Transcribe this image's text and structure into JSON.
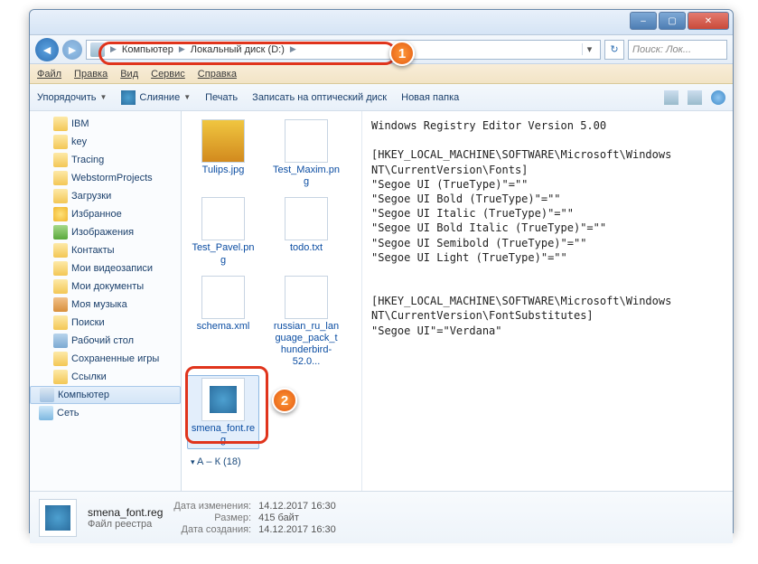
{
  "titlebar": {
    "min": "–",
    "max": "▢",
    "close": "✕"
  },
  "nav": {
    "back": "◄",
    "fwd": "►",
    "refresh": "↻",
    "dropdown": "▾",
    "crumbs": [
      "Компьютер",
      "Локальный диск (D:)"
    ],
    "search_placeholder": "Поиск: Лок..."
  },
  "menu": {
    "file": "Файл",
    "edit": "Правка",
    "view": "Вид",
    "service": "Сервис",
    "help": "Справка"
  },
  "toolbar": {
    "organize": "Упорядочить",
    "merge": "Слияние",
    "print": "Печать",
    "burn": "Записать на оптический диск",
    "newfolder": "Новая папка"
  },
  "tree": {
    "items": [
      {
        "label": "IBM",
        "ico": "ico-folder"
      },
      {
        "label": "key",
        "ico": "ico-folder"
      },
      {
        "label": "Tracing",
        "ico": "ico-folder"
      },
      {
        "label": "WebstormProjects",
        "ico": "ico-folder"
      },
      {
        "label": "Загрузки",
        "ico": "ico-folder"
      },
      {
        "label": "Избранное",
        "ico": "ico-star"
      },
      {
        "label": "Изображения",
        "ico": "ico-pic"
      },
      {
        "label": "Контакты",
        "ico": "ico-folder"
      },
      {
        "label": "Мои видеозаписи",
        "ico": "ico-folder"
      },
      {
        "label": "Мои документы",
        "ico": "ico-folder"
      },
      {
        "label": "Моя музыка",
        "ico": "ico-music"
      },
      {
        "label": "Поиски",
        "ico": "ico-folder"
      },
      {
        "label": "Рабочий стол",
        "ico": "ico-desktop"
      },
      {
        "label": "Сохраненные игры",
        "ico": "ico-folder"
      },
      {
        "label": "Ссылки",
        "ico": "ico-folder"
      }
    ],
    "computer": "Компьютер",
    "network": "Сеть"
  },
  "files": {
    "items": [
      {
        "name": "Tulips.jpg",
        "thumb": "img"
      },
      {
        "name": "Test_Maxim.png",
        "thumb": "txt"
      },
      {
        "name": "Test_Pavel.png",
        "thumb": "txt"
      },
      {
        "name": "todo.txt",
        "thumb": "txt"
      },
      {
        "name": "schema.xml",
        "thumb": "txt"
      },
      {
        "name": "russian_ru_language_pack_thunderbird-52.0...",
        "thumb": "txt"
      },
      {
        "name": "smena_font.reg",
        "thumb": "reg",
        "selected": true
      }
    ],
    "section": "А – К (18)"
  },
  "preview_text": "Windows Registry Editor Version 5.00\n\n[HKEY_LOCAL_MACHINE\\SOFTWARE\\Microsoft\\Windows NT\\CurrentVersion\\Fonts]\n\"Segoe UI (TrueType)\"=\"\"\n\"Segoe UI Bold (TrueType)\"=\"\"\n\"Segoe UI Italic (TrueType)\"=\"\"\n\"Segoe UI Bold Italic (TrueType)\"=\"\"\n\"Segoe UI Semibold (TrueType)\"=\"\"\n\"Segoe UI Light (TrueType)\"=\"\"\n\n\n[HKEY_LOCAL_MACHINE\\SOFTWARE\\Microsoft\\Windows NT\\CurrentVersion\\FontSubstitutes]\n\"Segoe UI\"=\"Verdana\"",
  "details": {
    "name": "smena_font.reg",
    "type": "Файл реестра",
    "labels": {
      "modified": "Дата изменения:",
      "size": "Размер:",
      "created": "Дата создания:"
    },
    "modified": "14.12.2017 16:30",
    "size": "415 байт",
    "created": "14.12.2017 16:30"
  },
  "callouts": {
    "one": "1",
    "two": "2"
  }
}
